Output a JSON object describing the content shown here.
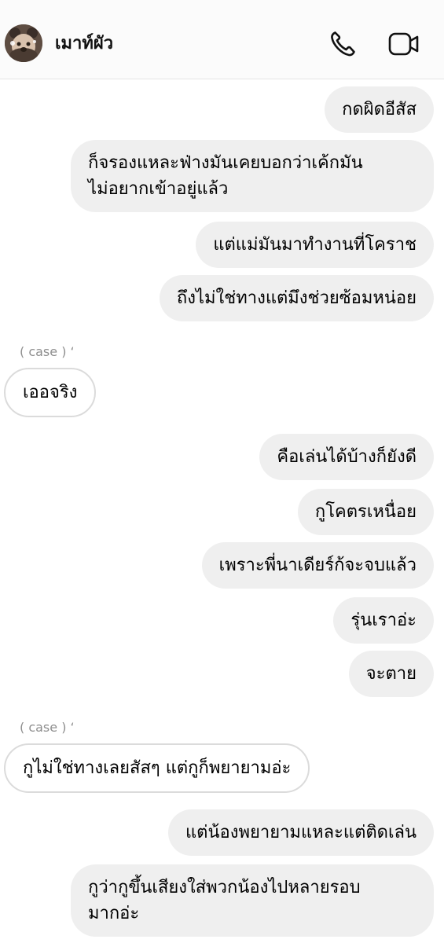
{
  "header": {
    "contact_name": "เมาท์ผัว",
    "call_icon": "phone-icon",
    "video_icon": "video-camera-icon"
  },
  "chat": {
    "sender_tag_1": "( case ) ‘",
    "sender_tag_2": "( case ) ‘",
    "messages": [
      {
        "direction": "out",
        "text": "กดผิดอีสัส"
      },
      {
        "direction": "out",
        "text": "ก็จรองแหละฟ่างมันเคยบอกว่าเค้กมัน\nไม่อยากเข้าอยู่แล้ว"
      },
      {
        "direction": "out",
        "text": "แต่แม่มันมาทำงานที่โคราช"
      },
      {
        "direction": "out",
        "text": "ถึงไม่ใช่ทางแต่มึงช่วยซ้อมหน่อย"
      },
      {
        "direction": "in",
        "text": "เออจริง"
      },
      {
        "direction": "out",
        "text": "คือเล่นได้บ้างก็ยังดี"
      },
      {
        "direction": "out",
        "text": "กูโคตรเหนื่อย"
      },
      {
        "direction": "out",
        "text": "เพราะพี่นาเดียร์ก้จะจบแล้ว"
      },
      {
        "direction": "out",
        "text": "รุ่นเราอ่ะ"
      },
      {
        "direction": "out",
        "text": "จะตาย"
      },
      {
        "direction": "in",
        "text": "กูไม่ใช่ทางเลยสัสๆ แต่กูก็พยายามอ่ะ"
      },
      {
        "direction": "out",
        "text": "แต่น้องพยายามแหละแต่ติดเล่น"
      },
      {
        "direction": "out",
        "text": "กูว่ากูขึ้นเสียงใส่พวกน้องไปหลายรอบ\nมากอ่ะ"
      }
    ]
  },
  "colors": {
    "outgoing_bubble": "#efefef",
    "incoming_border": "#dbdbdb",
    "sender_tag": "#8e8e8e"
  }
}
